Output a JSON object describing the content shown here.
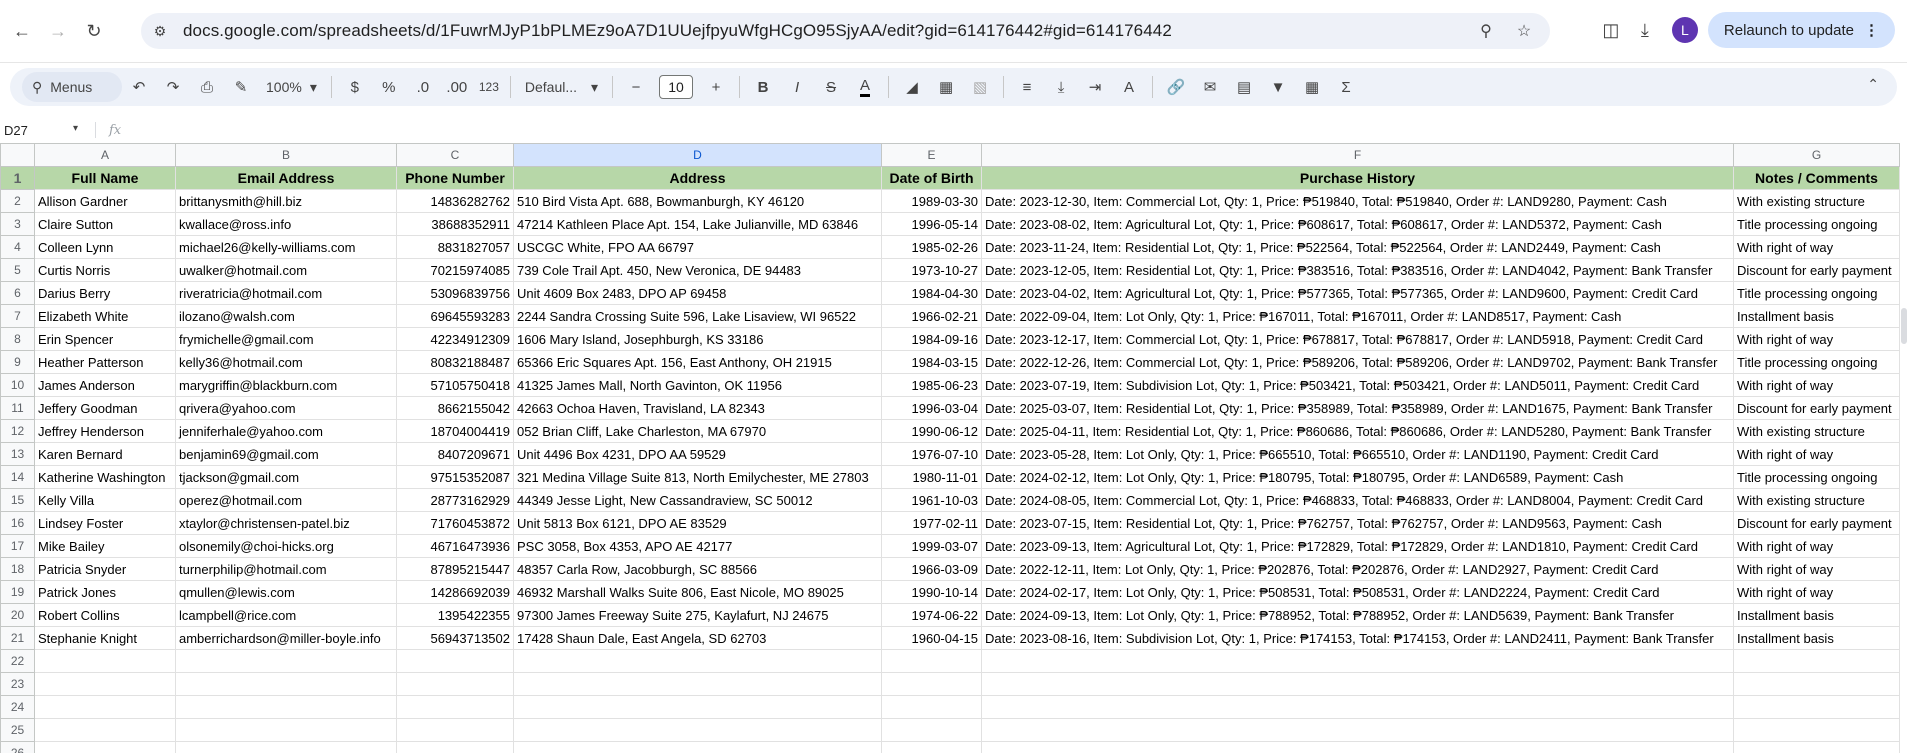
{
  "browser": {
    "url": "docs.google.com/spreadsheets/d/1FuwrMJyP1bPLMEz9oA7D1UUejfpyuWfgHCgO95SjyAA/edit?gid=614176442#gid=614176442",
    "relaunch_label": "Relaunch to update",
    "avatar_letter": "L"
  },
  "toolbar": {
    "menus_label": "Menus",
    "zoom": "100%",
    "currency": "$",
    "percent": "%",
    "dec_decrease": ".0",
    "dec_increase": ".00",
    "number_format": "123",
    "font": "Defaul...",
    "font_size": "10",
    "bold": "B",
    "italic": "I",
    "strike": "S",
    "text_color": "A",
    "text_rotate": "A",
    "sigma": "Σ"
  },
  "formula_bar": {
    "cell_ref": "D27",
    "fx": "fx"
  },
  "columns": [
    "A",
    "B",
    "C",
    "D",
    "E",
    "F",
    "G"
  ],
  "selected_column": "D",
  "header_row": [
    "Full Name",
    "Email Address",
    "Phone Number",
    "Address",
    "Date of Birth",
    "Purchase History",
    "Notes / Comments"
  ],
  "rows": [
    [
      "Allison Gardner",
      "brittanysmith@hill.biz",
      "14836282762",
      "510 Bird Vista Apt. 688, Bowmanburgh, KY 46120",
      "1989-03-30",
      "Date: 2023-12-30, Item: Commercial Lot, Qty: 1, Price: ₱519840, Total: ₱519840, Order #: LAND9280, Payment: Cash",
      "With existing structure"
    ],
    [
      "Claire Sutton",
      "kwallace@ross.info",
      "38688352911",
      "47214 Kathleen Place Apt. 154, Lake Julianville, MD 63846",
      "1996-05-14",
      "Date: 2023-08-02, Item: Agricultural Lot, Qty: 1, Price: ₱608617, Total: ₱608617, Order #: LAND5372, Payment: Cash",
      "Title processing ongoing"
    ],
    [
      "Colleen Lynn",
      "michael26@kelly-williams.com",
      "8831827057",
      "USCGC White, FPO AA 66797",
      "1985-02-26",
      "Date: 2023-11-24, Item: Residential Lot, Qty: 1, Price: ₱522564, Total: ₱522564, Order #: LAND2449, Payment: Cash",
      "With right of way"
    ],
    [
      "Curtis Norris",
      "uwalker@hotmail.com",
      "70215974085",
      "739 Cole Trail Apt. 450, New Veronica, DE 94483",
      "1973-10-27",
      "Date: 2023-12-05, Item: Residential Lot, Qty: 1, Price: ₱383516, Total: ₱383516, Order #: LAND4042, Payment: Bank Transfer",
      "Discount for early payment"
    ],
    [
      "Darius Berry",
      "riveratricia@hotmail.com",
      "53096839756",
      "Unit 4609 Box 2483, DPO AP 69458",
      "1984-04-30",
      "Date: 2023-04-02, Item: Agricultural Lot, Qty: 1, Price: ₱577365, Total: ₱577365, Order #: LAND9600, Payment: Credit Card",
      "Title processing ongoing"
    ],
    [
      "Elizabeth White",
      "ilozano@walsh.com",
      "69645593283",
      "2244 Sandra Crossing Suite 596, Lake Lisaview, WI 96522",
      "1966-02-21",
      "Date: 2022-09-04, Item: Lot Only, Qty: 1, Price: ₱167011, Total: ₱167011, Order #: LAND8517, Payment: Cash",
      "Installment basis"
    ],
    [
      "Erin Spencer",
      "frymichelle@gmail.com",
      "42234912309",
      "1606 Mary Island, Josephburgh, KS 33186",
      "1984-09-16",
      "Date: 2023-12-17, Item: Commercial Lot, Qty: 1, Price: ₱678817, Total: ₱678817, Order #: LAND5918, Payment: Credit Card",
      "With right of way"
    ],
    [
      "Heather Patterson",
      "kelly36@hotmail.com",
      "80832188487",
      "65366 Eric Squares Apt. 156, East Anthony, OH 21915",
      "1984-03-15",
      "Date: 2022-12-26, Item: Commercial Lot, Qty: 1, Price: ₱589206, Total: ₱589206, Order #: LAND9702, Payment: Bank Transfer",
      "Title processing ongoing"
    ],
    [
      "James Anderson",
      "marygriffin@blackburn.com",
      "57105750418",
      "41325 James Mall, North Gavinton, OK 11956",
      "1985-06-23",
      "Date: 2023-07-19, Item: Subdivision Lot, Qty: 1, Price: ₱503421, Total: ₱503421, Order #: LAND5011, Payment: Credit Card",
      "With right of way"
    ],
    [
      "Jeffery Goodman",
      "qrivera@yahoo.com",
      "8662155042",
      "42663 Ochoa Haven, Travisland, LA 82343",
      "1996-03-04",
      "Date: 2025-03-07, Item: Residential Lot, Qty: 1, Price: ₱358989, Total: ₱358989, Order #: LAND1675, Payment: Bank Transfer",
      "Discount for early payment"
    ],
    [
      "Jeffrey Henderson",
      "jenniferhale@yahoo.com",
      "18704004419",
      "052 Brian Cliff, Lake Charleston, MA 67970",
      "1990-06-12",
      "Date: 2025-04-11, Item: Residential Lot, Qty: 1, Price: ₱860686, Total: ₱860686, Order #: LAND5280, Payment: Bank Transfer",
      "With existing structure"
    ],
    [
      "Karen Bernard",
      "benjamin69@gmail.com",
      "8407209671",
      "Unit 4496 Box 4231, DPO AA 59529",
      "1976-07-10",
      "Date: 2023-05-28, Item: Lot Only, Qty: 1, Price: ₱665510, Total: ₱665510, Order #: LAND1190, Payment: Credit Card",
      "With right of way"
    ],
    [
      "Katherine Washington",
      "tjackson@gmail.com",
      "97515352087",
      "321 Medina Village Suite 813, North Emilychester, ME 27803",
      "1980-11-01",
      "Date: 2024-02-12, Item: Lot Only, Qty: 1, Price: ₱180795, Total: ₱180795, Order #: LAND6589, Payment: Cash",
      "Title processing ongoing"
    ],
    [
      "Kelly Villa",
      "operez@hotmail.com",
      "28773162929",
      "44349 Jesse Light, New Cassandraview, SC 50012",
      "1961-10-03",
      "Date: 2024-08-05, Item: Commercial Lot, Qty: 1, Price: ₱468833, Total: ₱468833, Order #: LAND8004, Payment: Credit Card",
      "With existing structure"
    ],
    [
      "Lindsey Foster",
      "xtaylor@christensen-patel.biz",
      "71760453872",
      "Unit 5813 Box 6121, DPO AE 83529",
      "1977-02-11",
      "Date: 2023-07-15, Item: Residential Lot, Qty: 1, Price: ₱762757, Total: ₱762757, Order #: LAND9563, Payment: Cash",
      "Discount for early payment"
    ],
    [
      "Mike Bailey",
      "olsonemily@choi-hicks.org",
      "46716473936",
      "PSC 3058, Box 4353, APO AE 42177",
      "1999-03-07",
      "Date: 2023-09-13, Item: Agricultural Lot, Qty: 1, Price: ₱172829, Total: ₱172829, Order #: LAND1810, Payment: Credit Card",
      "With right of way"
    ],
    [
      "Patricia Snyder",
      "turnerphilip@hotmail.com",
      "87895215447",
      "48357 Carla Row, Jacobburgh, SC 88566",
      "1966-03-09",
      "Date: 2022-12-11, Item: Lot Only, Qty: 1, Price: ₱202876, Total: ₱202876, Order #: LAND2927, Payment: Credit Card",
      "With right of way"
    ],
    [
      "Patrick Jones",
      "qmullen@lewis.com",
      "14286692039",
      "46932 Marshall Walks Suite 806, East Nicole, MO 89025",
      "1990-10-14",
      "Date: 2024-02-17, Item: Lot Only, Qty: 1, Price: ₱508531, Total: ₱508531, Order #: LAND2224, Payment: Credit Card",
      "With right of way"
    ],
    [
      "Robert Collins",
      "lcampbell@rice.com",
      "1395422355",
      "97300 James Freeway Suite 275, Kaylafurt, NJ 24675",
      "1974-06-22",
      "Date: 2024-09-13, Item: Lot Only, Qty: 1, Price: ₱788952, Total: ₱788952, Order #: LAND5639, Payment: Bank Transfer",
      "Installment basis"
    ],
    [
      "Stephanie Knight",
      "amberrichardson@miller-boyle.info",
      "56943713502",
      "17428 Shaun Dale, East Angela, SD 62703",
      "1960-04-15",
      "Date: 2023-08-16, Item: Subdivision Lot, Qty: 1, Price: ₱174153, Total: ₱174153, Order #: LAND2411, Payment: Bank Transfer",
      "Installment basis"
    ]
  ],
  "empty_row_numbers": [
    "22",
    "23",
    "24",
    "25",
    "26"
  ]
}
